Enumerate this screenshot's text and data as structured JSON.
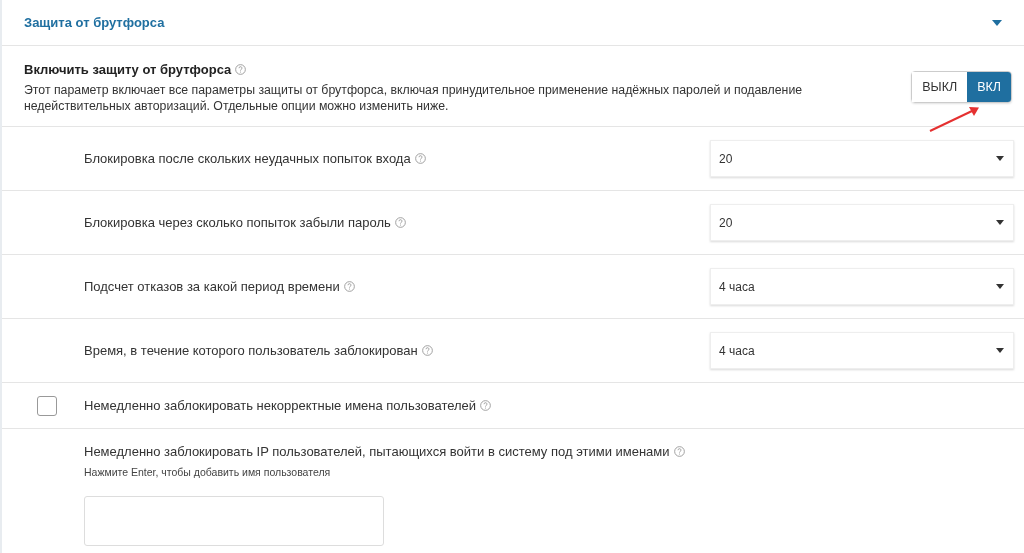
{
  "section": {
    "title": "Защита от брутфорса",
    "expanded": true
  },
  "main_option": {
    "title": "Включить защиту от брутфорса",
    "description": "Этот параметр включает все параметры защиты от брутфорса, включая принудительное применение надёжных паролей и подавление недействительных авторизаций. Отдельные опции можно изменить ниже.",
    "toggle": [
      {
        "label": "ВЫКЛ",
        "selected": false
      },
      {
        "label": "ВКЛ",
        "selected": true
      }
    ]
  },
  "settings": [
    {
      "kind": "select",
      "label": "Блокировка после скольких неудачных попыток входа",
      "value": "20"
    },
    {
      "kind": "select",
      "label": "Блокировка через сколько попыток забыли пароль",
      "value": "20"
    },
    {
      "kind": "select",
      "label": "Подсчет отказов за какой период времени",
      "value": "4 часа"
    },
    {
      "kind": "select",
      "label": "Время, в течение которого пользователь заблокирован",
      "value": "4 часа"
    },
    {
      "kind": "checkbox",
      "label": "Немедленно заблокировать некорректные имена пользователей",
      "checked": false
    },
    {
      "kind": "textarea",
      "label": "Немедленно заблокировать IP пользователей, пытающихся войти в систему под этими именами",
      "hint": "Нажмите Enter, чтобы добавить имя пользователя"
    }
  ]
}
